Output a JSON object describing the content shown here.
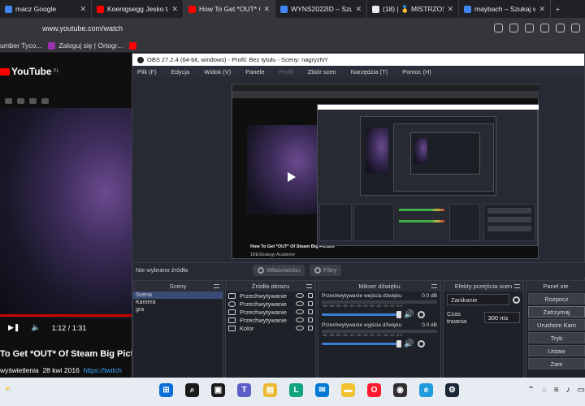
{
  "browser": {
    "tabs": [
      {
        "label": "macz Google",
        "icon": "google-icon",
        "color": "#4285f4",
        "active": false
      },
      {
        "label": "Koenigsegg Jesko ta",
        "icon": "youtube-icon",
        "color": "#ff0000",
        "active": false
      },
      {
        "label": "How To Get *OUT* O",
        "icon": "youtube-icon",
        "color": "#ff0000",
        "active": true
      },
      {
        "label": "WYNS2022ID – Szuk",
        "icon": "google-icon",
        "color": "#4285f4",
        "active": false
      },
      {
        "label": "(18) | 🥇 MISTRZOSTW",
        "icon": "page-icon",
        "color": "#e8eaed",
        "active": false
      },
      {
        "label": "maybach – Szukaj w",
        "icon": "google-icon",
        "color": "#4285f4",
        "active": false
      }
    ],
    "new_tab": "+",
    "url": "www.youtube.com/watch",
    "bookmarks": [
      {
        "label": "umber Tyco...",
        "icon": "bookmark-icon",
        "color": "#888888"
      },
      {
        "label": "Zaloguj się | Ortogr...",
        "icon": "ortograf-icon",
        "color": "#9b2fae"
      },
      {
        "label": "",
        "icon": "youtube-icon",
        "color": "#ff0000"
      }
    ]
  },
  "youtube": {
    "logo": "YouTube",
    "region": "PL",
    "time_current": "1:12",
    "time_total": "1:31",
    "progress": 0.79,
    "time_text": "1:12 / 1:31",
    "title": "To Get *OUT* Of Steam Big Pict",
    "views": "wyświetlenia",
    "date": "28 kwi 2016",
    "tags": "https://twitch"
  },
  "obs": {
    "title": "OBS 27.2.4 (64-bit, windows) - Profil: Bez tytułu - Sceny: nagryzNY",
    "menu": [
      "Plik (F)",
      "Edycja",
      "Widok (V)",
      "Panele",
      "Profil",
      "Zbiór scen",
      "Narzędzia (T)",
      "Pomoc (H)"
    ],
    "menu_disabled": "Profil",
    "preview": {
      "nested_title": "How To Get *OUT* Of Steam Big Picture",
      "nested_channel": "1BEStrategy Academy",
      "nested_date": "28 kwi 2016"
    },
    "source_bar": {
      "no_source": "Nie wybrano źródła",
      "properties": "Właściwości",
      "filters": "Filtry"
    },
    "scenes": {
      "header": "Sceny",
      "items": [
        "Scena",
        "Kamera",
        "gra"
      ],
      "selected": "Scena"
    },
    "sources": {
      "header": "Źródła obrazu",
      "items": [
        {
          "label": "Przechwytywanie",
          "icon": "speaker-icon"
        },
        {
          "label": "Przechwytywanie",
          "icon": "microphone-icon"
        },
        {
          "label": "Przechwytywanie",
          "icon": "monitor-icon"
        },
        {
          "label": "Przechwytywanie",
          "icon": "window-icon"
        },
        {
          "label": "Kolor",
          "icon": "paint-brush-icon"
        }
      ]
    },
    "mixer": {
      "header": "Mikser dźwięku",
      "channels": [
        {
          "name": "Przechwytywanie wejścia dźwięku",
          "db": "0.0 dB"
        },
        {
          "name": "Przechwytywanie wyjścia dźwięku",
          "db": "0.0 dB"
        }
      ],
      "scale": "-60 -55 -50 -45 -40 -35 -30 -25 -20 -15 -10 -5 0"
    },
    "transitions": {
      "header": "Efekty przejścia scen",
      "type": "Zanikanie",
      "duration_label": "Czas trwania",
      "duration": "300 ms"
    },
    "controls": {
      "header": "Panel ste",
      "buttons": [
        "Rozpocz",
        "Zatrzymaj",
        "Uruchom Kam",
        "Tryb",
        "Ustaw",
        "Zam"
      ]
    }
  },
  "taskbar": {
    "weather": "⛅",
    "apps": [
      {
        "name": "start-icon",
        "color": "#0a6dd8",
        "glyph": "⊞"
      },
      {
        "name": "search-icon",
        "color": "#1b1b1b",
        "glyph": "⌕"
      },
      {
        "name": "task-view-icon",
        "color": "#1b1b1b",
        "glyph": "▣"
      },
      {
        "name": "teams-icon",
        "color": "#5b5fc7",
        "glyph": "T"
      },
      {
        "name": "file-explorer-icon",
        "color": "#e8b931",
        "glyph": "▤"
      },
      {
        "name": "app-l-icon",
        "color": "#10a37f",
        "glyph": "L"
      },
      {
        "name": "mail-icon",
        "color": "#0078d4",
        "glyph": "✉"
      },
      {
        "name": "folder-icon",
        "color": "#f2c12e",
        "glyph": "▬"
      },
      {
        "name": "opera-icon",
        "color": "#ff1b2d",
        "glyph": "O"
      },
      {
        "name": "obs-icon",
        "color": "#302e31",
        "glyph": "◉"
      },
      {
        "name": "edge-icon",
        "color": "#1f9bde",
        "glyph": "e"
      },
      {
        "name": "steam-icon",
        "color": "#1b2838",
        "glyph": "⚙"
      }
    ],
    "tray": [
      "⌃",
      "◌",
      "≡",
      "♪",
      "▭"
    ]
  }
}
